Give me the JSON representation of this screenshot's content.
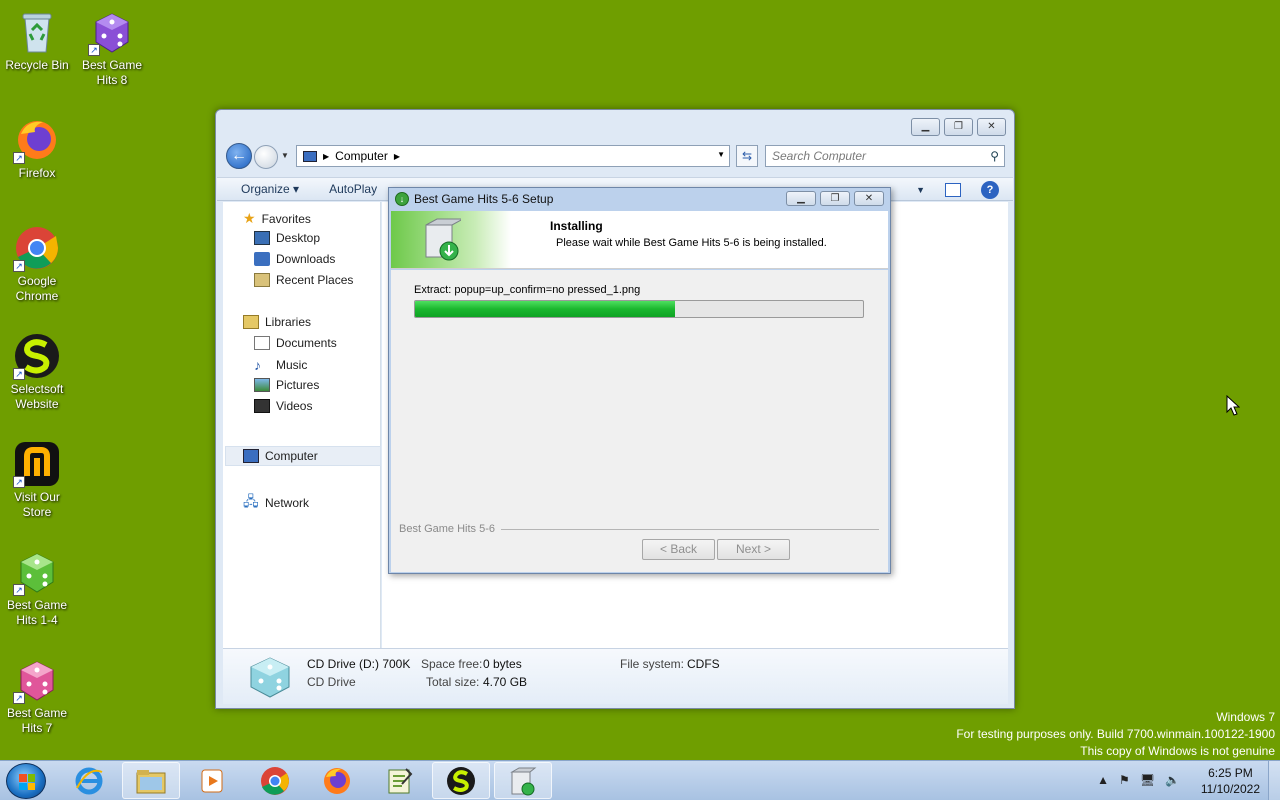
{
  "desktop": {
    "icons": [
      {
        "label": "Recycle Bin"
      },
      {
        "label": "Best Game Hits 8"
      },
      {
        "label": "Firefox"
      },
      {
        "label": "Google Chrome"
      },
      {
        "label": "Selectsoft Website"
      },
      {
        "label": "Visit Our Store"
      },
      {
        "label": "Best Game Hits 1-4"
      },
      {
        "label": "Best Game Hits 7"
      }
    ]
  },
  "explorer": {
    "address": "Computer",
    "search_placeholder": "Search Computer",
    "toolbar": {
      "organize": "Organize",
      "autoplay": "AutoPlay"
    },
    "nav": {
      "favorites": "Favorites",
      "desktop": "Desktop",
      "downloads": "Downloads",
      "recent": "Recent Places",
      "libraries": "Libraries",
      "documents": "Documents",
      "music": "Music",
      "pictures": "Pictures",
      "videos": "Videos",
      "computer": "Computer",
      "network": "Network"
    },
    "details": {
      "drive_name": "CD Drive (D:) 700K",
      "drive_type": "CD Drive",
      "space_free_label": "Space free:",
      "space_free": "0 bytes",
      "total_size_label": "Total size:",
      "total_size": "4.70 GB",
      "fs_label": "File system:",
      "fs": "CDFS"
    }
  },
  "setup": {
    "title": "Best Game Hits 5-6 Setup",
    "heading": "Installing",
    "subheading": "Please wait while Best Game Hits 5-6 is being installed.",
    "status": "Extract: popup=up_confirm=no pressed_1.png",
    "progress": 0.58,
    "brand": "Best Game Hits 5-6",
    "back_label": "< Back",
    "next_label": "Next >"
  },
  "watermark": {
    "line1": "Windows 7",
    "line2": "For testing purposes only. Build 7700.winmain.100122-1900",
    "line3": "This copy of Windows is not genuine"
  },
  "taskbar": {
    "time": "6:25 PM",
    "date": "11/10/2022"
  },
  "colors": {
    "desktop": "#6f9e00",
    "progress": "#1bb72f"
  }
}
